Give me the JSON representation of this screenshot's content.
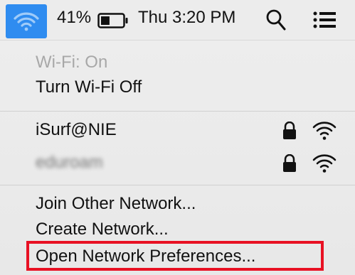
{
  "menubar": {
    "battery_percent": "41%",
    "battery_level": 0.41,
    "clock": "Thu 3:20 PM",
    "wifi_icon": "wifi-icon",
    "search_icon": "search-icon",
    "list_icon": "notification-list-icon"
  },
  "wifi_menu": {
    "status": "Wi-Fi: On",
    "toggle_label": "Turn Wi-Fi Off",
    "networks": [
      {
        "name": "iSurf@NIE",
        "secured": true,
        "icon": "wifi-signal-icon"
      },
      {
        "name": "eduroam",
        "secured": true,
        "icon": "wifi-signal-icon"
      }
    ],
    "join_other": "Join Other Network...",
    "create_network": "Create Network...",
    "open_prefs": "Open Network Preferences..."
  },
  "colors": {
    "highlight_border": "#e81123",
    "wifi_button_bg": "#2f8cf0"
  }
}
